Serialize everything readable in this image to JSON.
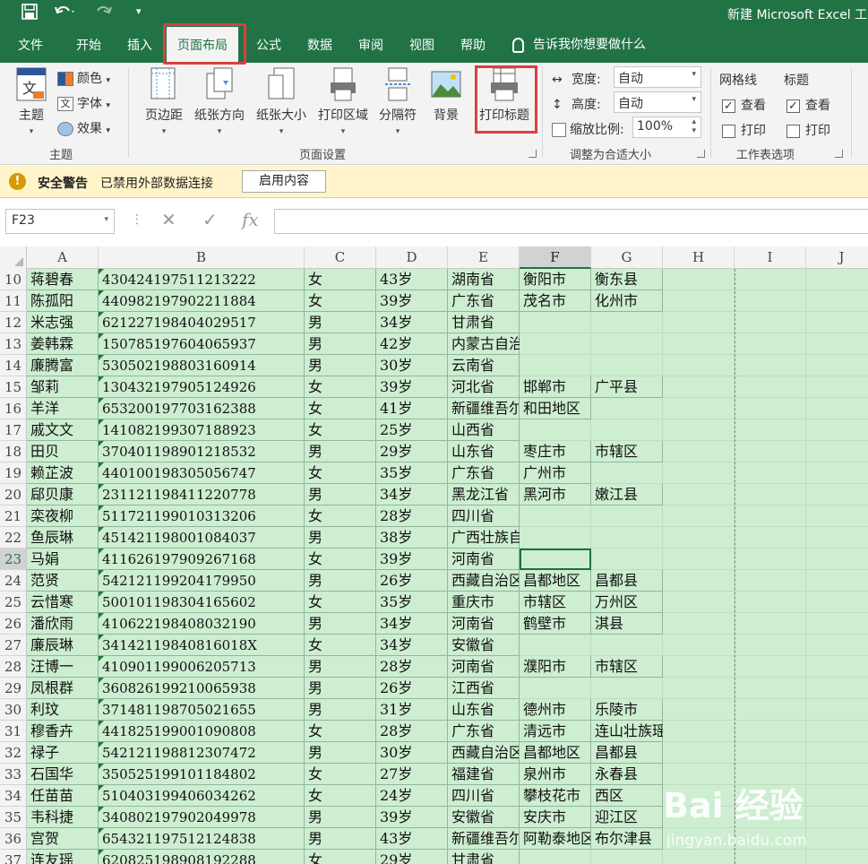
{
  "app": {
    "title": "新建 Microsoft Excel 工",
    "qat": [
      "save-icon",
      "undo-icon",
      "redo-icon",
      "customize-icon"
    ]
  },
  "tabs": [
    {
      "label": "文件"
    },
    {
      "label": "开始"
    },
    {
      "label": "插入"
    },
    {
      "label": "页面布局"
    },
    {
      "label": "公式"
    },
    {
      "label": "数据"
    },
    {
      "label": "审阅"
    },
    {
      "label": "视图"
    },
    {
      "label": "帮助"
    }
  ],
  "active_tab": "页面布局",
  "tell_me": "告诉我你想要做什么",
  "ribbon": {
    "theme_group": {
      "label": "主题",
      "theme_btn": "主题",
      "colors": "颜色",
      "fonts": "字体",
      "effects": "效果"
    },
    "page_setup": {
      "label": "页面设置",
      "margins": "页边距",
      "orientation": "纸张方向",
      "size": "纸张大小",
      "print_area": "打印区域",
      "breaks": "分隔符",
      "background": "背景",
      "print_titles": "打印标题"
    },
    "scale_group": {
      "label": "调整为合适大小",
      "width_label": "宽度:",
      "width_value": "自动",
      "height_label": "高度:",
      "height_value": "自动",
      "scale_label": "缩放比例:",
      "scale_value": "100%"
    },
    "sheet_options": {
      "label": "工作表选项",
      "gridlines": "网格线",
      "headings": "标题",
      "view": "查看",
      "print": "打印",
      "gridlines_view": true,
      "gridlines_print": false,
      "headings_view": true,
      "headings_print": false
    }
  },
  "security_bar": {
    "title": "安全警告",
    "message": "已禁用外部数据连接",
    "button": "启用内容"
  },
  "formula_bar": {
    "name_box": "F23",
    "fx": "fx",
    "value": ""
  },
  "columns": [
    "A",
    "B",
    "C",
    "D",
    "E",
    "F",
    "G",
    "H",
    "I",
    "J"
  ],
  "selected_column": "F",
  "selected_row": "23",
  "rows": [
    {
      "n": "10",
      "a": "蒋碧春",
      "b": "430424197511213222",
      "c": "女",
      "d": "43岁",
      "e": "湖南省",
      "f": "衡阳市",
      "g": "衡东县"
    },
    {
      "n": "11",
      "a": "陈孤阳",
      "b": "440982197902211884",
      "c": "女",
      "d": "39岁",
      "e": "广东省",
      "f": "茂名市",
      "g": "化州市"
    },
    {
      "n": "12",
      "a": "米志强",
      "b": "621227198404029517",
      "c": "男",
      "d": "34岁",
      "e": "甘肃省",
      "f": "",
      "g": ""
    },
    {
      "n": "13",
      "a": "姜韩霖",
      "b": "150785197604065937",
      "c": "男",
      "d": "42岁",
      "e": "内蒙古自治区",
      "f": "",
      "g": ""
    },
    {
      "n": "14",
      "a": "廉腾富",
      "b": "530502198803160914",
      "c": "男",
      "d": "30岁",
      "e": "云南省",
      "f": "",
      "g": ""
    },
    {
      "n": "15",
      "a": "邹莉",
      "b": "130432197905124926",
      "c": "女",
      "d": "39岁",
      "e": "河北省",
      "f": "邯郸市",
      "g": "广平县"
    },
    {
      "n": "16",
      "a": "羊洋",
      "b": "653200197703162388",
      "c": "女",
      "d": "41岁",
      "e": "新疆维吾尔",
      "f": "和田地区",
      "g": ""
    },
    {
      "n": "17",
      "a": "戚文文",
      "b": "141082199307188923",
      "c": "女",
      "d": "25岁",
      "e": "山西省",
      "f": "",
      "g": ""
    },
    {
      "n": "18",
      "a": "田贝",
      "b": "370401198901218532",
      "c": "男",
      "d": "29岁",
      "e": "山东省",
      "f": "枣庄市",
      "g": "市辖区"
    },
    {
      "n": "19",
      "a": "赖芷波",
      "b": "440100198305056747",
      "c": "女",
      "d": "35岁",
      "e": "广东省",
      "f": "广州市",
      "g": ""
    },
    {
      "n": "20",
      "a": "郈贝康",
      "b": "231121198411220778",
      "c": "男",
      "d": "34岁",
      "e": "黑龙江省",
      "f": "黑河市",
      "g": "嫩江县"
    },
    {
      "n": "21",
      "a": "栾夜柳",
      "b": "511721199010313206",
      "c": "女",
      "d": "28岁",
      "e": "四川省",
      "f": "",
      "g": ""
    },
    {
      "n": "22",
      "a": "鱼辰琳",
      "b": "451421198001084037",
      "c": "男",
      "d": "38岁",
      "e": "广西壮族自治区",
      "f": "",
      "g": ""
    },
    {
      "n": "23",
      "a": "马娟",
      "b": "411626197909267168",
      "c": "女",
      "d": "39岁",
      "e": "河南省",
      "f": "",
      "g": ""
    },
    {
      "n": "24",
      "a": "范贤",
      "b": "542121199204179950",
      "c": "男",
      "d": "26岁",
      "e": "西藏自治区",
      "f": "昌都地区",
      "g": "昌都县"
    },
    {
      "n": "25",
      "a": "云惜寒",
      "b": "500101198304165602",
      "c": "女",
      "d": "35岁",
      "e": "重庆市",
      "f": "市辖区",
      "g": "万州区"
    },
    {
      "n": "26",
      "a": "潘欣雨",
      "b": "410622198408032190",
      "c": "男",
      "d": "34岁",
      "e": "河南省",
      "f": "鹤壁市",
      "g": "淇县"
    },
    {
      "n": "27",
      "a": "廉辰琳",
      "b": "34142119840816018X",
      "c": "女",
      "d": "34岁",
      "e": "安徽省",
      "f": "",
      "g": ""
    },
    {
      "n": "28",
      "a": "汪博一",
      "b": "410901199006205713",
      "c": "男",
      "d": "28岁",
      "e": "河南省",
      "f": "濮阳市",
      "g": "市辖区"
    },
    {
      "n": "29",
      "a": "凤根群",
      "b": "360826199210065938",
      "c": "男",
      "d": "26岁",
      "e": "江西省",
      "f": "",
      "g": ""
    },
    {
      "n": "30",
      "a": "利玟",
      "b": "371481198705021655",
      "c": "男",
      "d": "31岁",
      "e": "山东省",
      "f": "德州市",
      "g": "乐陵市"
    },
    {
      "n": "31",
      "a": "穆香卉",
      "b": "441825199001090808",
      "c": "女",
      "d": "28岁",
      "e": "广东省",
      "f": "清远市",
      "g": "连山壮族瑶族自治县"
    },
    {
      "n": "32",
      "a": "禄子",
      "b": "542121198812307472",
      "c": "男",
      "d": "30岁",
      "e": "西藏自治区",
      "f": "昌都地区",
      "g": "昌都县"
    },
    {
      "n": "33",
      "a": "石国华",
      "b": "350525199101184802",
      "c": "女",
      "d": "27岁",
      "e": "福建省",
      "f": "泉州市",
      "g": "永春县"
    },
    {
      "n": "34",
      "a": "任苗苗",
      "b": "510403199406034262",
      "c": "女",
      "d": "24岁",
      "e": "四川省",
      "f": "攀枝花市",
      "g": "西区"
    },
    {
      "n": "35",
      "a": "韦科捷",
      "b": "340802197902049978",
      "c": "男",
      "d": "39岁",
      "e": "安徽省",
      "f": "安庆市",
      "g": "迎江区"
    },
    {
      "n": "36",
      "a": "宫贺",
      "b": "654321197512124838",
      "c": "男",
      "d": "43岁",
      "e": "新疆维吾尔",
      "f": "阿勒泰地区",
      "g": "布尔津县"
    },
    {
      "n": "37",
      "a": "连友瑶",
      "b": "620825198908192288",
      "c": "女",
      "d": "29岁",
      "e": "甘肃省",
      "f": "",
      "g": ""
    }
  ],
  "watermark": {
    "brand": "Bai 经验",
    "url": "jingyan.baidu.com"
  },
  "colors": {
    "excel_green": "#217346",
    "table_fill": "#cdeed1",
    "highlight": "#d94040"
  }
}
